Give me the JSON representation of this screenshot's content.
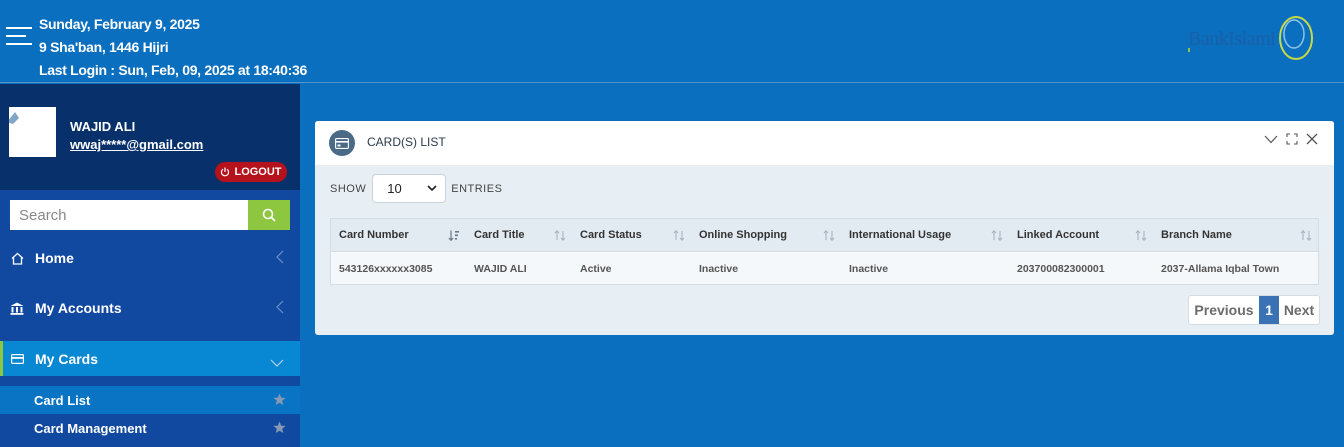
{
  "header": {
    "date_gregorian": "Sunday, February 9, 2025",
    "date_hijri": "9 Sha'ban, 1446 Hijri",
    "last_login": "Last Login : Sun, Feb, 09, 2025 at 18:40:36",
    "logo_text": "BankIslami"
  },
  "user": {
    "name": "WAJID ALI",
    "email": "wwaj*****@gmail.com",
    "logout_label": "LOGOUT"
  },
  "search": {
    "placeholder": "Search"
  },
  "nav": {
    "home": "Home",
    "my_accounts": "My Accounts",
    "my_cards": "My Cards",
    "sub": {
      "card_list": "Card List",
      "card_management": "Card Management"
    }
  },
  "panel": {
    "title": "CARD(S) LIST",
    "show_label": "SHOW",
    "entries_label": "ENTRIES",
    "page_size": "10",
    "columns": [
      "Card Number",
      "Card Title",
      "Card Status",
      "Online Shopping",
      "International Usage",
      "Linked Account",
      "Branch Name"
    ],
    "rows": [
      [
        "543126xxxxxx3085",
        "WAJID ALI",
        "Active",
        "Inactive",
        "Inactive",
        "203700082300001",
        "2037-Allama Iqbal Town"
      ]
    ],
    "pager": {
      "previous": "Previous",
      "current": "1",
      "next": "Next"
    }
  },
  "colors": {
    "primary_blue": "#0a6fbe",
    "sidebar": "#1149a0",
    "user_box": "#08316b",
    "accent_green": "#8dc63f",
    "logout_red": "#b5121b"
  }
}
